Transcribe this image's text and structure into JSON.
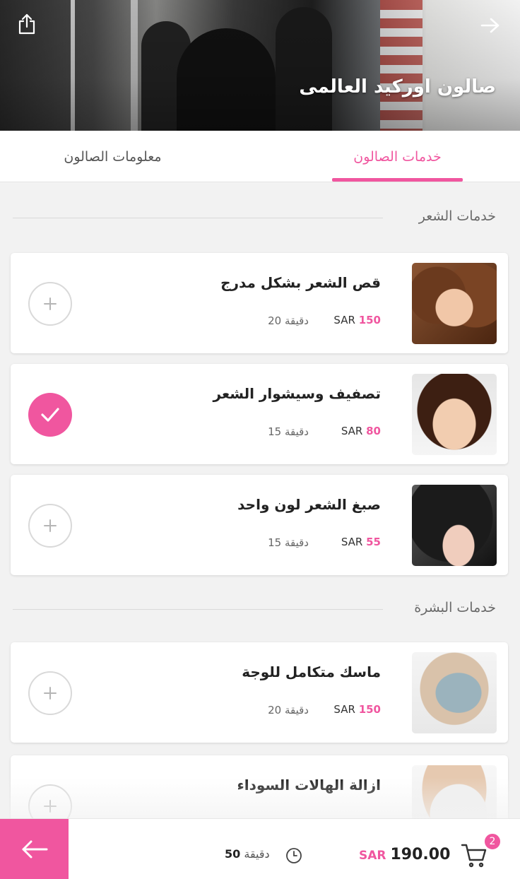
{
  "header": {
    "title": "صالون اوركيد العالمى",
    "share_icon": "share-icon",
    "back_icon": "arrow-right-icon"
  },
  "tabs": [
    {
      "label": "خدمات الصالون",
      "active": true
    },
    {
      "label": "معلومات الصالون",
      "active": false
    }
  ],
  "sections": [
    {
      "title": "خدمات الشعر",
      "services": [
        {
          "name": "قص الشعر بشكل مدرج",
          "price": "150",
          "currency": "SAR",
          "duration": "20 دقيقة",
          "selected": false
        },
        {
          "name": "تصفيف وسيشوار الشعر",
          "price": "80",
          "currency": "SAR",
          "duration": "15 دقيقة",
          "selected": true
        },
        {
          "name": "صبغ الشعر لون واحد",
          "price": "55",
          "currency": "SAR",
          "duration": "15 دقيقة",
          "selected": false
        }
      ]
    },
    {
      "title": "خدمات البشرة",
      "services": [
        {
          "name": "ماسك متكامل للوجة",
          "price": "150",
          "currency": "SAR",
          "duration": "20 دقيقة",
          "selected": false
        },
        {
          "name": "ازالة الهالات السوداء",
          "selected": false
        }
      ]
    }
  ],
  "footer": {
    "total_amount": "190.00",
    "currency": "SAR",
    "total_duration_value": "50",
    "total_duration_unit": "دقيقة",
    "cart_count": "2",
    "next_icon": "arrow-left-icon"
  },
  "colors": {
    "accent": "#f0569f"
  }
}
